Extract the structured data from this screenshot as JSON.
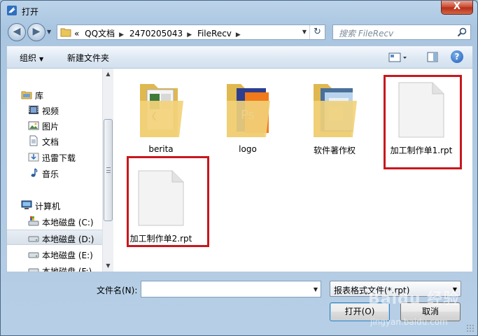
{
  "window": {
    "title": "打开",
    "close_label": "X"
  },
  "address": {
    "overflow": "«",
    "crumbs": [
      "QQ文档",
      "2470205043",
      "FileRecv"
    ]
  },
  "search": {
    "placeholder": "搜索 FileRecv"
  },
  "toolbar": {
    "organize_label": "组织",
    "new_folder_label": "新建文件夹",
    "help_label": "?"
  },
  "sidebar": {
    "items": [
      {
        "label": "库",
        "icon": "library-icon"
      },
      {
        "label": "视频",
        "icon": "video-icon"
      },
      {
        "label": "图片",
        "icon": "pictures-icon"
      },
      {
        "label": "文档",
        "icon": "documents-icon"
      },
      {
        "label": "迅雷下载",
        "icon": "download-icon"
      },
      {
        "label": "音乐",
        "icon": "music-icon"
      },
      {
        "label": "计算机",
        "icon": "computer-icon"
      },
      {
        "label": "本地磁盘 (C:)",
        "icon": "drive-c-icon"
      },
      {
        "label": "本地磁盘 (D:)",
        "icon": "drive-icon"
      },
      {
        "label": "本地磁盘 (E:)",
        "icon": "drive-icon"
      },
      {
        "label": "本地磁盘 (F:)",
        "icon": "drive-icon"
      }
    ],
    "selected_index": 8
  },
  "files": [
    {
      "name": "berita",
      "kind": "folder"
    },
    {
      "name": "logo",
      "kind": "folder"
    },
    {
      "name": "软件著作权",
      "kind": "folder"
    },
    {
      "name": "加工制作单1.rpt",
      "kind": "file"
    },
    {
      "name": "加工制作单2.rpt",
      "kind": "file"
    }
  ],
  "footer": {
    "filename_label": "文件名(N):",
    "filename_value": "",
    "filetype_value": "报表格式文件(*.rpt)",
    "open_label": "打开(O)",
    "cancel_label": "取消"
  },
  "watermark": {
    "main": "Baidu 经验",
    "sub": "jingyan.baidu.com"
  },
  "colors": {
    "highlight": "#c8171d",
    "accent": "#3c7fb1"
  }
}
